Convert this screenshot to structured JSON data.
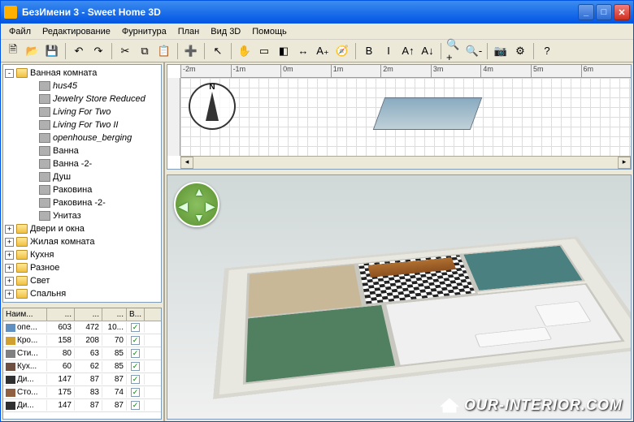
{
  "window": {
    "title": "БезИмени 3 - Sweet Home 3D"
  },
  "menu": [
    "Файл",
    "Редактирование",
    "Фурнитура",
    "План",
    "Вид 3D",
    "Помощь"
  ],
  "toolbar_icons": [
    "new-file-icon",
    "open-icon",
    "save-icon",
    "undo-icon",
    "redo-icon",
    "cut-icon",
    "copy-icon",
    "paste-icon",
    "add-furniture-icon",
    "cursor-icon",
    "hand-icon",
    "wall-icon",
    "room-icon",
    "dimension-icon",
    "text-icon",
    "compass-icon",
    "text-bold-icon",
    "text-italic-icon",
    "text-size-up-icon",
    "text-size-down-icon",
    "zoom-in-icon",
    "zoom-out-icon",
    "camera-icon",
    "preferences-icon",
    "help-icon"
  ],
  "toolbar_glyphs": [
    "🗎",
    "📂",
    "💾",
    "↶",
    "↷",
    "✂",
    "⧉",
    "📋",
    "➕",
    "↖",
    "✋",
    "▭",
    "◧",
    "↔",
    "A₊",
    "🧭",
    "B",
    "I",
    "A↑",
    "A↓",
    "🔍+",
    "🔍-",
    "📷",
    "⚙",
    "?"
  ],
  "tree": {
    "root": {
      "label": "Ванная комната",
      "expanded": true,
      "icon": "folder"
    },
    "children": [
      {
        "label": "hus45",
        "italic": true
      },
      {
        "label": "Jewelry Store Reduced",
        "italic": true
      },
      {
        "label": "Living For Two",
        "italic": true
      },
      {
        "label": "Living For Two II",
        "italic": true
      },
      {
        "label": "openhouse_berging",
        "italic": true
      },
      {
        "label": "Ванна",
        "italic": false
      },
      {
        "label": "Ванна -2-",
        "italic": false
      },
      {
        "label": "Душ",
        "italic": false
      },
      {
        "label": "Раковина",
        "italic": false
      },
      {
        "label": "Раковина -2-",
        "italic": false
      },
      {
        "label": "Унитаз",
        "italic": false
      }
    ],
    "siblings": [
      {
        "label": "Двери и окна"
      },
      {
        "label": "Жилая комната"
      },
      {
        "label": "Кухня"
      },
      {
        "label": "Разное"
      },
      {
        "label": "Свет"
      },
      {
        "label": "Спальня"
      }
    ]
  },
  "table": {
    "headers": [
      "Наим...",
      "...",
      "...",
      "...",
      "В..."
    ],
    "rows": [
      {
        "name": "опе...",
        "w": "603",
        "d": "472",
        "h": "10...",
        "vis": true,
        "color": "#6090c0"
      },
      {
        "name": "Кро...",
        "w": "158",
        "d": "208",
        "h": "70",
        "vis": true,
        "color": "#d0a030"
      },
      {
        "name": "Сти...",
        "w": "80",
        "d": "63",
        "h": "85",
        "vis": true,
        "color": "#808080"
      },
      {
        "name": "Кух...",
        "w": "60",
        "d": "62",
        "h": "85",
        "vis": true,
        "color": "#705040"
      },
      {
        "name": "Ди...",
        "w": "147",
        "d": "87",
        "h": "87",
        "vis": true,
        "color": "#303030"
      },
      {
        "name": "Сто...",
        "w": "175",
        "d": "83",
        "h": "74",
        "vis": true,
        "color": "#906040"
      },
      {
        "name": "Ди...",
        "w": "147",
        "d": "87",
        "h": "87",
        "vis": true,
        "color": "#303030"
      }
    ]
  },
  "ruler": [
    "-2m",
    "-1m",
    "0m",
    "1m",
    "2m",
    "3m",
    "4m",
    "5m",
    "6m"
  ],
  "watermark": "OUR-INTERIOR.COM"
}
